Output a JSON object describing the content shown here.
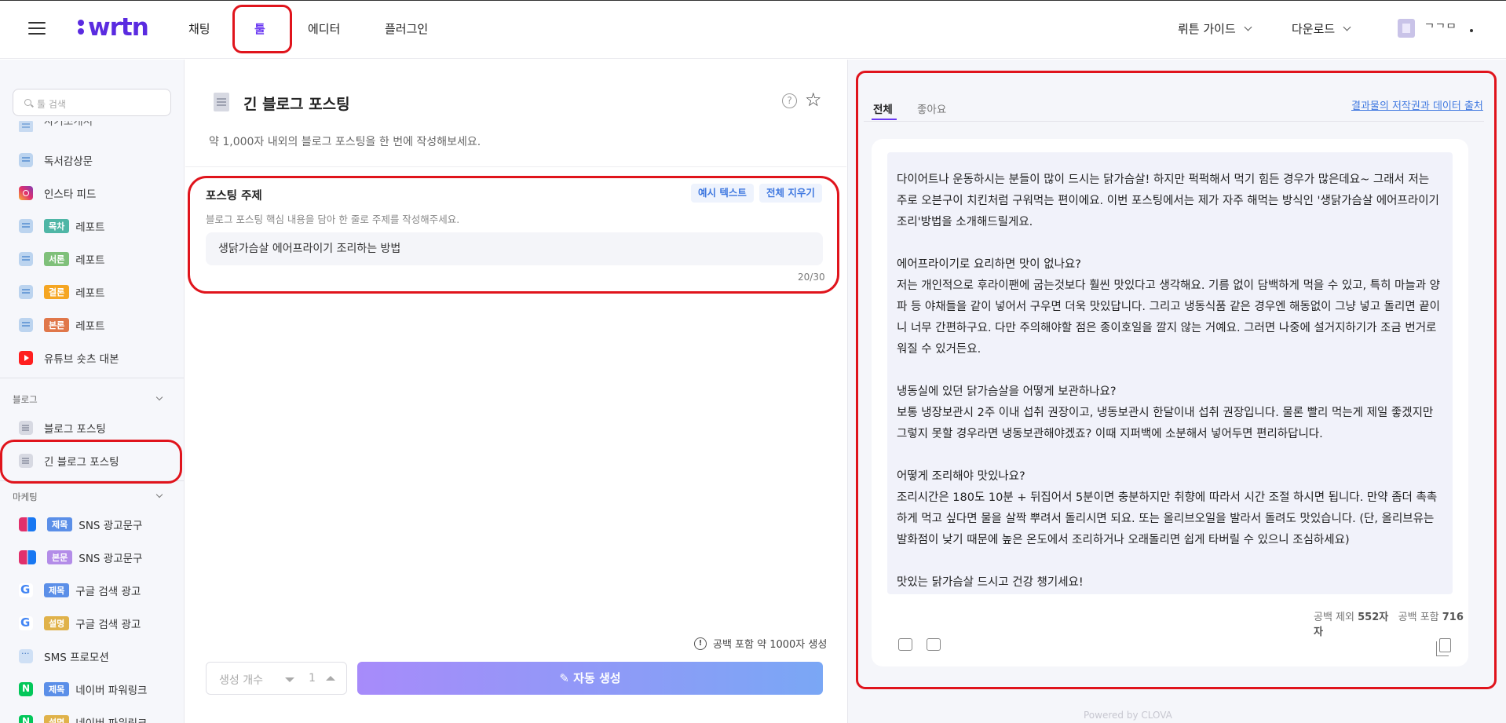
{
  "header": {
    "logo": "wrtn",
    "nav": [
      "채팅",
      "툴",
      "에디터",
      "플러그인"
    ],
    "guide_label": "뤼튼 가이드",
    "download_label": "다운로드",
    "user_name": "ᄀᄀᄆ"
  },
  "sidebar": {
    "search_placeholder": "툴 검색",
    "cut_item": "자기소개서",
    "items_top": [
      {
        "label": "독서감상문",
        "tag": null,
        "icon": "doc-icon"
      },
      {
        "label": "인스타 피드",
        "tag": null,
        "icon": "instagram-icon"
      },
      {
        "label": "레포트",
        "tag": "목차",
        "tag_color": "#4fb6a6",
        "icon": "doc-icon"
      },
      {
        "label": "레포트",
        "tag": "서론",
        "tag_color": "#7fc07a",
        "icon": "doc-icon"
      },
      {
        "label": "레포트",
        "tag": "결론",
        "tag_color": "#f5a623",
        "icon": "doc-icon"
      },
      {
        "label": "레포트",
        "tag": "본론",
        "tag_color": "#e0774a",
        "icon": "doc-icon"
      },
      {
        "label": "유튜브 숏츠 대본",
        "tag": null,
        "icon": "youtube-icon"
      }
    ],
    "section_blog": "블로그",
    "blog_items": [
      "블로그 포스팅",
      "긴 블로그 포스팅"
    ],
    "section_marketing": "마케팅",
    "marketing_items": [
      {
        "label": "SNS 광고문구",
        "tag": "제목",
        "tag_color": "#5b8fe8",
        "icon": "instagram-facebook-icon"
      },
      {
        "label": "SNS 광고문구",
        "tag": "본문",
        "tag_color": "#b38ce8",
        "icon": "instagram-facebook-icon"
      },
      {
        "label": "구글 검색 광고",
        "tag": "제목",
        "tag_color": "#5b8fe8",
        "icon": "google-icon"
      },
      {
        "label": "구글 검색 광고",
        "tag": "설명",
        "tag_color": "#e0b24a",
        "icon": "google-icon"
      },
      {
        "label": "SMS 프로모션",
        "tag": null,
        "icon": "sms-icon"
      },
      {
        "label": "네이버 파워링크",
        "tag": "제목",
        "tag_color": "#5b8fe8",
        "icon": "naver-icon"
      },
      {
        "label": "네이버 파워링크",
        "tag": "설명",
        "tag_color": "#e0b24a",
        "icon": "naver-icon"
      }
    ]
  },
  "main": {
    "title": "긴 블로그 포스팅",
    "description": "약 1,000자 내외의 블로그 포스팅을 한 번에 작성해보세요.",
    "field_label": "포스팅 주제",
    "example_button": "예시 텍스트",
    "clear_button": "전체 지우기",
    "field_hint": "블로그 포스팅 핵심 내용을 담아 한 줄로 주제를 작성해주세요.",
    "field_value": "생닭가슴살 에어프라이기 조리하는 방법",
    "field_count": "20/30",
    "generation_note": "공백 포함 약 1000자 생성",
    "count_label": "생성 개수",
    "count_value": "1",
    "generate_button": "자동 생성"
  },
  "result": {
    "tab_all": "전체",
    "tab_like": "좋아요",
    "copyright_link": "결과물의 저작권과 데이터 출처",
    "paragraphs": [
      [
        "다이어트나 운동하시는 분들이 많이 드시는 닭가슴살! 하지만 퍽퍽해서 먹기 힘든 경우가 많은데요~ 그래서 저는 주로 오븐구이 치킨처럼 구워먹는 편이에요. 이번 포스팅에서는 제가 자주 해먹는 방식인 '생닭가슴살 에어프라이기 조리'방법을 소개해드릴게요."
      ],
      [
        "에어프라이기로 요리하면 맛이 없나요?",
        "저는 개인적으로 후라이팬에 굽는것보다 훨씬 맛있다고 생각해요. 기름 없이 담백하게 먹을 수 있고, 특히 마늘과 양파 등 야채들을 같이 넣어서 구우면 더욱 맛있답니다. 그리고 냉동식품 같은 경우엔 해동없이 그냥 넣고 돌리면 끝이니 너무 간편하구요. 다만 주의해야할 점은 종이호일을 깔지 않는 거예요. 그러면 나중에 설거지하기가 조금 번거로워질 수 있거든요."
      ],
      [
        "냉동실에 있던 닭가슴살을 어떻게 보관하나요?",
        "보통 냉장보관시 2주 이내 섭취 권장이고, 냉동보관시 한달이내 섭취 권장입니다. 물론 빨리 먹는게 제일 좋겠지만 그렇지 못할 경우라면 냉동보관해야겠죠? 이때 지퍼백에 소분해서 넣어두면 편리하답니다."
      ],
      [
        "어떻게 조리해야 맛있나요?",
        "조리시간은 180도 10분 + 뒤집어서 5분이면 충분하지만 취향에 따라서 시간 조절 하시면 됩니다. 만약 좀더 촉촉하게 먹고 싶다면 물을 살짝 뿌려서 돌리시면 되요. 또는 올리브오일을 발라서 돌려도 맛있습니다. (단, 올리브유는 발화점이 낮기 때문에 높은 온도에서 조리하거나 오래돌리면 쉽게 타버릴 수 있으니 조심하세요)"
      ],
      [
        " 맛있는 닭가슴살 드시고 건강 챙기세요!"
      ]
    ],
    "stats_excl_label": "공백 제외",
    "stats_excl_value": "552자",
    "stats_incl_label": "공백 포함",
    "stats_incl_value": "716자",
    "powered_by": "Powered by CLOVA"
  },
  "colors": {
    "brand": "#5a2be0",
    "accent": "#6a38f2",
    "highlight": "#e0141c",
    "link": "#3f78e0"
  }
}
